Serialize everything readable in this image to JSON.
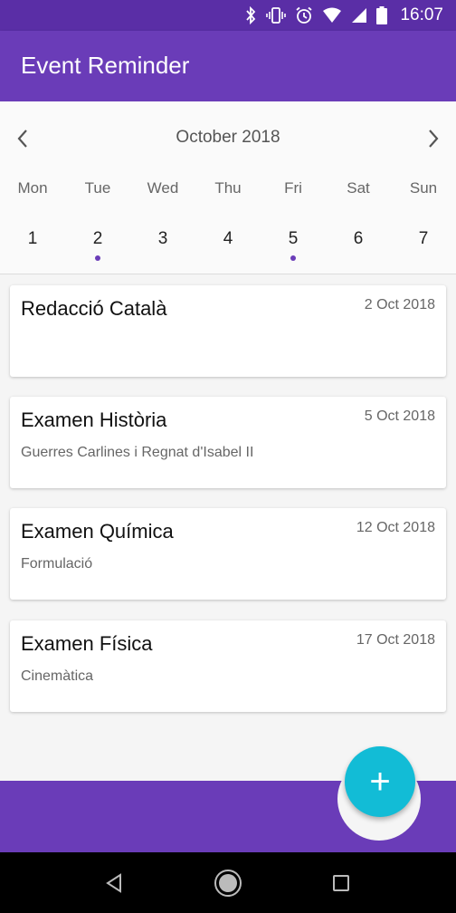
{
  "status_bar": {
    "time": "16:07",
    "icons": [
      "bluetooth-icon",
      "vibrate-icon",
      "alarm-icon",
      "wifi-icon",
      "signal-icon",
      "battery-icon"
    ]
  },
  "app_bar": {
    "title": "Event Reminder"
  },
  "calendar": {
    "month_label": "October 2018",
    "weekdays": [
      "Mon",
      "Tue",
      "Wed",
      "Thu",
      "Fri",
      "Sat",
      "Sun"
    ],
    "days": [
      "1",
      "2",
      "3",
      "4",
      "5",
      "6",
      "7"
    ],
    "event_day_markers": [
      "2",
      "5"
    ]
  },
  "events": [
    {
      "title": "Redacció Català",
      "date": "2 Oct 2018",
      "subtitle": ""
    },
    {
      "title": "Examen Història",
      "date": "5 Oct 2018",
      "subtitle": "Guerres Carlines i Regnat d'Isabel II"
    },
    {
      "title": "Examen Química",
      "date": "12 Oct 2018",
      "subtitle": "Formulació"
    },
    {
      "title": "Examen Física",
      "date": "17 Oct 2018",
      "subtitle": "Cinemàtica"
    }
  ],
  "fab": {
    "label": "+"
  },
  "colors": {
    "primary": "#6a3cb8",
    "status": "#5a2ea6",
    "accent": "#12bcd6"
  }
}
